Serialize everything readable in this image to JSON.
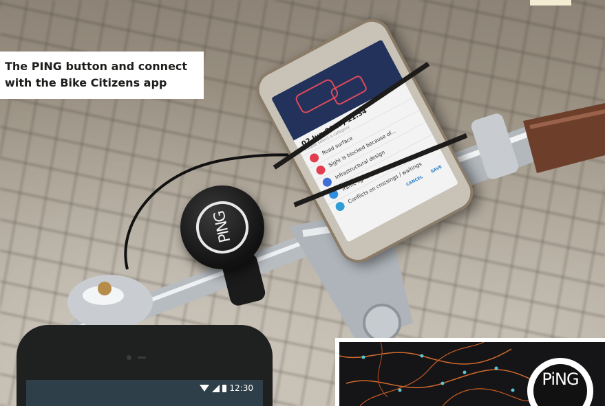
{
  "caption": {
    "line1": "The PING button and connect",
    "line2": "with the Bike Citizens app"
  },
  "mounted_phone": {
    "date": "02 Jun 2017, 11:34",
    "hint": "Please select a category",
    "categories": [
      {
        "label": "Road surface",
        "color": "#e23c4f"
      },
      {
        "label": "Sight is blocked because of...",
        "color": "#e23c4f"
      },
      {
        "label": "Infrastructural design",
        "color": "#3f6fd6"
      },
      {
        "label": "Traffic lights",
        "color": "#2f8fe0"
      },
      {
        "label": "Conflicts on crossings / waitings",
        "color": "#2f9ed6"
      }
    ],
    "extra_icon_color": "#f08a24",
    "cancel_label": "CANCEL",
    "save_label": "SAVE"
  },
  "ping_button": {
    "logo_text": "PING"
  },
  "bottom_phone": {
    "time": "12:30",
    "status_icons": [
      "wifi-icon",
      "signal-icon",
      "battery-icon"
    ]
  },
  "map_thumbnail": {
    "logo_text": "PiNG",
    "route_color": "#d46a2e",
    "node_color": "#5bc6d6"
  }
}
